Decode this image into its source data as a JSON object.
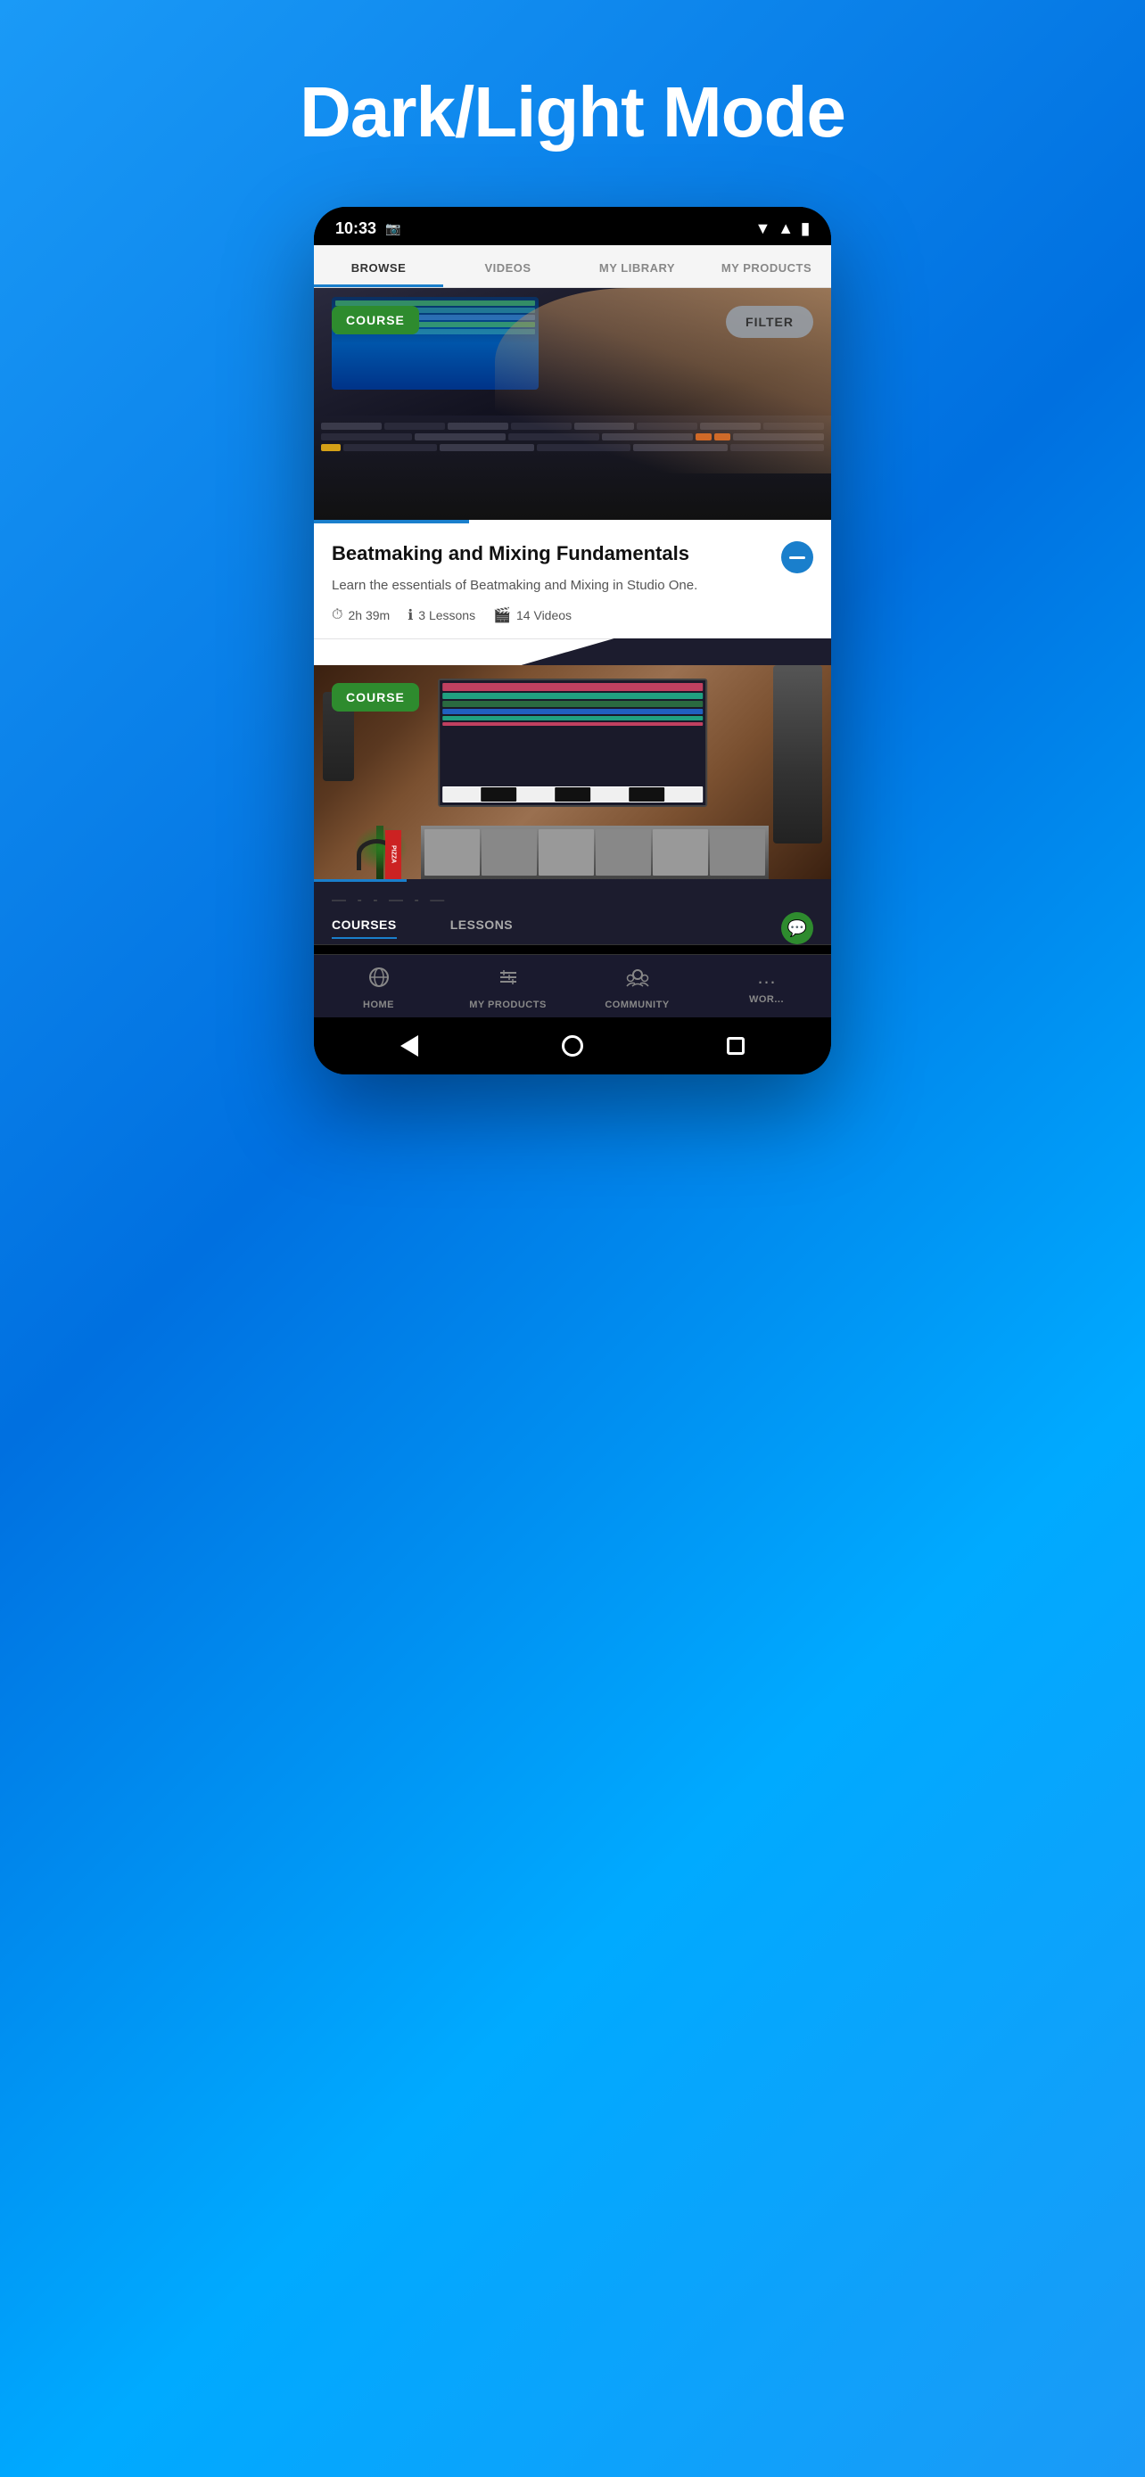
{
  "page": {
    "title": "Dark/Light Mode",
    "background_gradient_start": "#1a9af7",
    "background_gradient_end": "#0070e0"
  },
  "status_bar": {
    "time": "10:33",
    "wifi_icon": "wifi",
    "signal_icon": "signal",
    "battery_icon": "battery"
  },
  "nav_tabs": {
    "items": [
      {
        "label": "BROWSE",
        "active": true
      },
      {
        "label": "VIDEOS",
        "active": false
      },
      {
        "label": "MY LIBRARY",
        "active": false
      },
      {
        "label": "MY PRODUCTS",
        "active": false
      }
    ]
  },
  "course_card_1": {
    "badge": "COURSE",
    "filter_button": "FILTER",
    "title": "Beatmaking and Mixing Fundamentals",
    "description": "Learn the essentials of Beatmaking and Mixing in Studio One.",
    "duration": "2h 39m",
    "lessons": "3 Lessons",
    "videos": "14 Videos"
  },
  "course_card_2": {
    "badge": "COURSE"
  },
  "sub_tabs": {
    "items": [
      {
        "label": "COURSES",
        "active": true
      },
      {
        "label": "LESSONS",
        "active": false
      }
    ],
    "chat_icon": "💬"
  },
  "bottom_nav": {
    "items": [
      {
        "label": "HOME",
        "icon": "⊕",
        "active": false
      },
      {
        "label": "MY PRODUCTS",
        "icon": "≡",
        "active": false
      },
      {
        "label": "COMMUNITY",
        "icon": "⊙",
        "active": false
      },
      {
        "label": "WOR...",
        "icon": "…",
        "active": false
      }
    ]
  },
  "android_nav": {
    "back": "back",
    "home": "home",
    "recent": "recent"
  }
}
